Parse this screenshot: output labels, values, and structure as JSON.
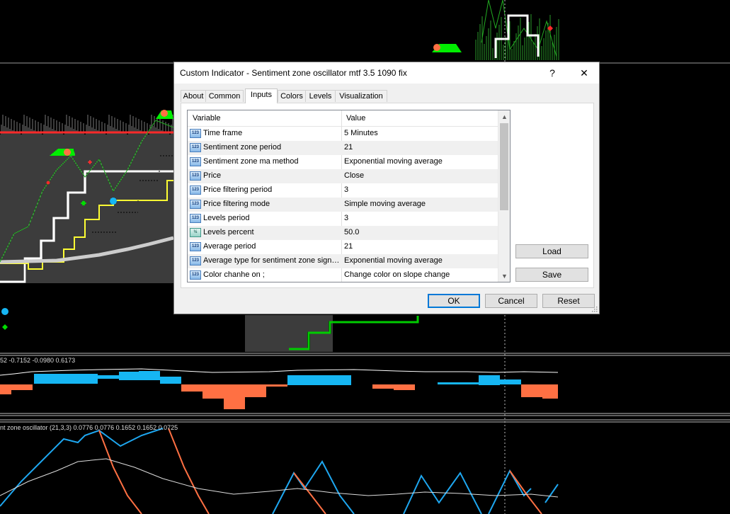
{
  "chart": {
    "colors": {
      "background": "#000000",
      "bars": "#777777",
      "up_line": "#00cc00",
      "level_white": "#ffffff",
      "level_yellow": "#ffff33",
      "signal_red": "#ff2a2a",
      "hist_blue": "#16b6f3",
      "hist_orange": "#ff7043",
      "osc_blue": "#1ea7f0",
      "osc_orange": "#ff7043"
    },
    "sub1_label": "52 -0.7152 -0.0980 0.6173",
    "sub2_label": "nt zone oscillator (21,3,3) 0.0776 0.0776 0.1652 0.1652 0.0725"
  },
  "dialog": {
    "title": "Custom Indicator - Sentiment zone oscillator mtf 3.5 1090 fix",
    "help_label": "?",
    "close_label": "✕",
    "tabs": [
      {
        "label": "About"
      },
      {
        "label": "Common"
      },
      {
        "label": "Inputs"
      },
      {
        "label": "Colors"
      },
      {
        "label": "Levels"
      },
      {
        "label": "Visualization"
      }
    ],
    "active_tab": "Inputs",
    "grid": {
      "col_variable": "Variable",
      "col_value": "Value",
      "rows": [
        {
          "icon": "123",
          "variable": "Time frame",
          "value": "5 Minutes"
        },
        {
          "icon": "123",
          "variable": "Sentiment zone period",
          "value": "21"
        },
        {
          "icon": "123",
          "variable": "Sentiment zone ma method",
          "value": "Exponential moving average"
        },
        {
          "icon": "123",
          "variable": "Price",
          "value": "Close"
        },
        {
          "icon": "123",
          "variable": "Price filtering period",
          "value": "3"
        },
        {
          "icon": "123",
          "variable": "Price filtering mode",
          "value": "Simple moving average"
        },
        {
          "icon": "123",
          "variable": "Levels period",
          "value": "3"
        },
        {
          "icon": "½",
          "variable": "Levels percent",
          "value": "50.0"
        },
        {
          "icon": "123",
          "variable": "Average period",
          "value": "21"
        },
        {
          "icon": "123",
          "variable": "Average type for sentiment zone signal...",
          "value": "Exponential moving average"
        },
        {
          "icon": "123",
          "variable": "Color chanhe on ;",
          "value": "Change color on slope change"
        }
      ]
    },
    "buttons": {
      "load": "Load",
      "save": "Save",
      "ok": "OK",
      "cancel": "Cancel",
      "reset": "Reset"
    }
  }
}
